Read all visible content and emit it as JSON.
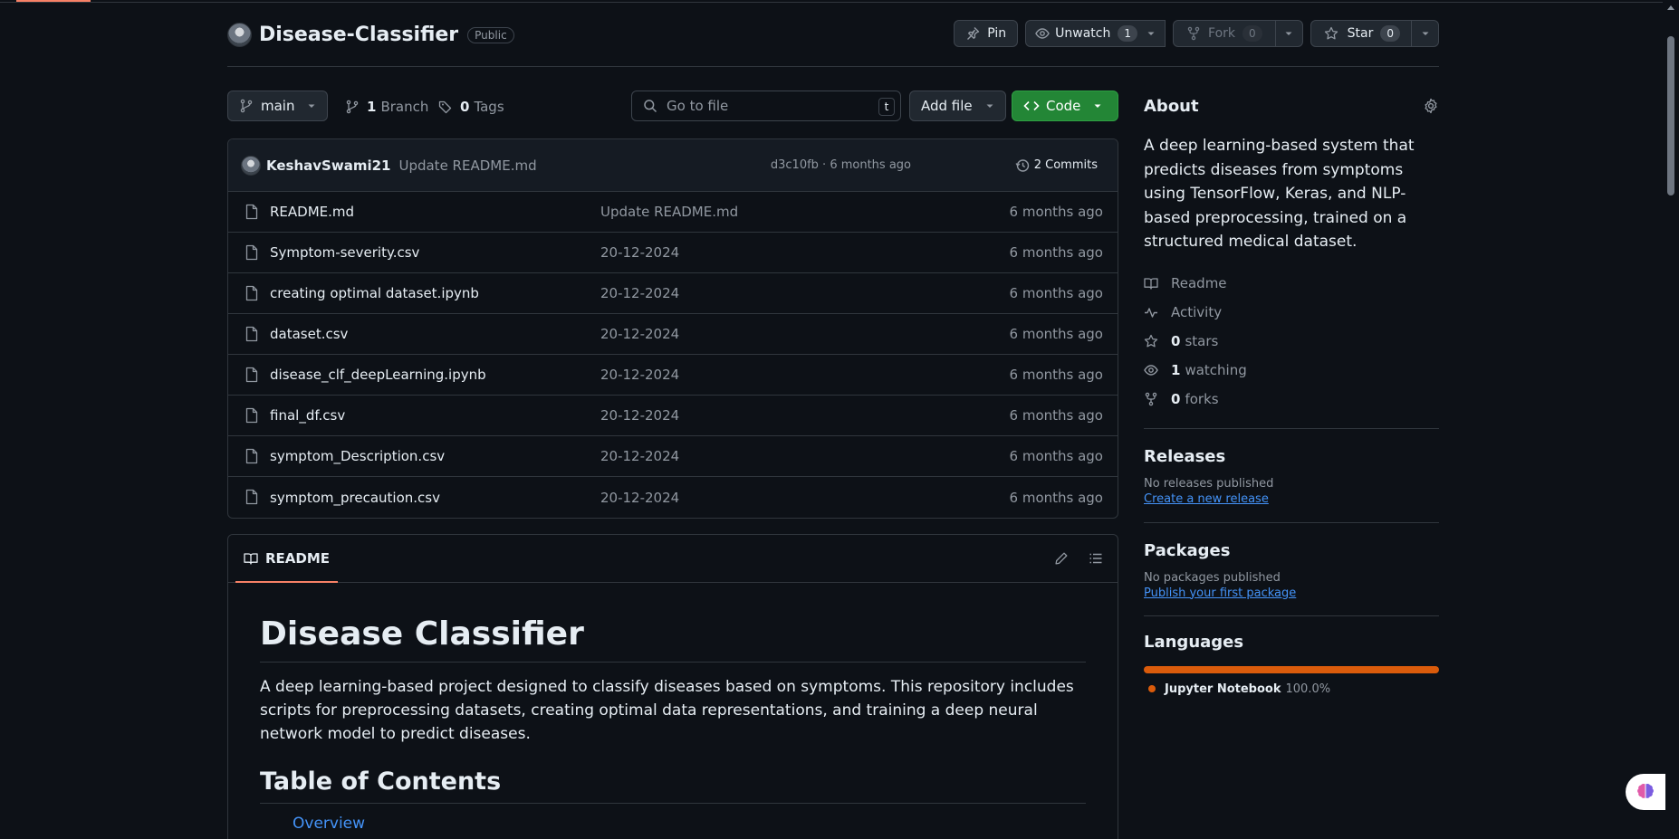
{
  "repo": {
    "name": "Disease-Classifier",
    "visibility": "Public"
  },
  "actions": {
    "pin": "Pin",
    "watch": "Unwatch",
    "watch_count": "1",
    "fork": "Fork",
    "fork_count": "0",
    "star": "Star",
    "star_count": "0"
  },
  "toolbar": {
    "branch": "main",
    "branch_count": "1",
    "branch_label": "Branch",
    "tag_count": "0",
    "tag_label": "Tags",
    "search_placeholder": "Go to file",
    "search_kbd": "t",
    "add_file": "Add file",
    "code": "Code"
  },
  "latest_commit": {
    "author": "KeshavSwami21",
    "message": "Update README.md",
    "hash_time": "d3c10fb · 6 months ago",
    "commits": "2 Commits"
  },
  "files": [
    {
      "name": "README.md",
      "message": "Update README.md",
      "time": "6 months ago"
    },
    {
      "name": "Symptom-severity.csv",
      "message": "20-12-2024",
      "time": "6 months ago"
    },
    {
      "name": "creating optimal dataset.ipynb",
      "message": "20-12-2024",
      "time": "6 months ago"
    },
    {
      "name": "dataset.csv",
      "message": "20-12-2024",
      "time": "6 months ago"
    },
    {
      "name": "disease_clf_deepLearning.ipynb",
      "message": "20-12-2024",
      "time": "6 months ago"
    },
    {
      "name": "final_df.csv",
      "message": "20-12-2024",
      "time": "6 months ago"
    },
    {
      "name": "symptom_Description.csv",
      "message": "20-12-2024",
      "time": "6 months ago"
    },
    {
      "name": "symptom_precaution.csv",
      "message": "20-12-2024",
      "time": "6 months ago"
    }
  ],
  "readme": {
    "tab": "README",
    "title": "Disease Classifier",
    "intro": "A deep learning-based project designed to classify diseases based on symptoms. This repository includes scripts for preprocessing datasets, creating optimal data representations, and training a deep neural network model to predict diseases.",
    "toc_title": "Table of Contents",
    "toc_first": "Overview"
  },
  "about": {
    "title": "About",
    "description": "A deep learning-based system that predicts diseases from symptoms using TensorFlow, Keras, and NLP-based preprocessing, trained on a structured medical dataset.",
    "readme": "Readme",
    "activity": "Activity",
    "stars_count": "0",
    "stars_label": "stars",
    "watching_count": "1",
    "watching_label": "watching",
    "forks_count": "0",
    "forks_label": "forks"
  },
  "releases": {
    "title": "Releases",
    "none": "No releases published",
    "link": "Create a new release"
  },
  "packages": {
    "title": "Packages",
    "none": "No packages published",
    "link": "Publish your first package"
  },
  "languages": {
    "title": "Languages",
    "name": "Jupyter Notebook",
    "percent": "100.0%",
    "color": "#da5b0b"
  }
}
